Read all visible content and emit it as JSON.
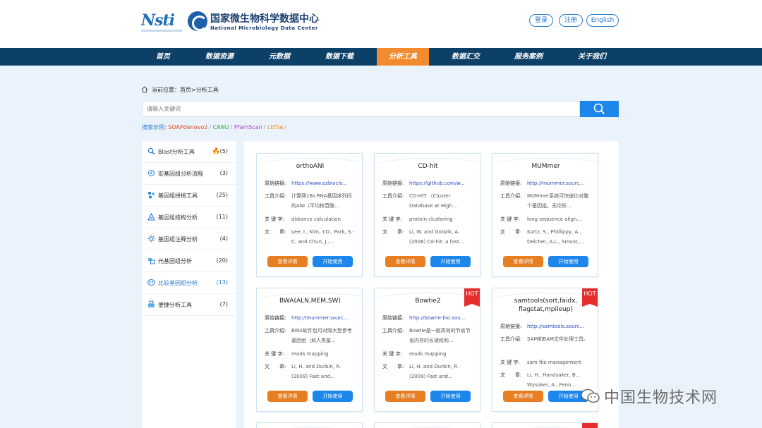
{
  "header": {
    "logo_nsti": "Nsti",
    "logo_cn": "国家微生物科学数据中心",
    "logo_en": "National Microbiology Data Center",
    "login": "登录",
    "register": "注册",
    "english": "English"
  },
  "nav": {
    "items": [
      "首页",
      "数据资源",
      "元数据",
      "数据下载",
      "分析工具",
      "数据汇交",
      "服务案例",
      "关于我们"
    ],
    "active": "分析工具"
  },
  "breadcrumb": {
    "label": "当前位置：",
    "path": "首页>分析工具"
  },
  "search": {
    "placeholder": "请输入关键词"
  },
  "examples": {
    "label": "搜索示例:",
    "items": [
      {
        "text": "SOAPdenovo2",
        "color": "#e8451c"
      },
      {
        "text": "CANU",
        "color": "#2e9e3a"
      },
      {
        "text": "PfamScan",
        "color": "#b33cc8"
      },
      {
        "text": "LEfSe",
        "color": "#f28a2e"
      }
    ]
  },
  "sidebar": {
    "items": [
      {
        "label": "Blast分析工具",
        "count": "(5)",
        "icon": "blast-icon",
        "hot": true
      },
      {
        "label": "宏基因组分析流程",
        "count": "(3)",
        "icon": "metagenome-icon"
      },
      {
        "label": "基因组拼接工具",
        "count": "(25)",
        "icon": "assembly-icon"
      },
      {
        "label": "基因组结构分析",
        "count": "(11)",
        "icon": "structure-icon"
      },
      {
        "label": "基因组注释分析",
        "count": "(4)",
        "icon": "annotation-icon"
      },
      {
        "label": "元基因组分析",
        "count": "(20)",
        "icon": "meta-icon"
      },
      {
        "label": "比较基因组分析",
        "count": "(13)",
        "icon": "compare-icon",
        "active": true
      },
      {
        "label": "便捷分析工具",
        "count": "(7)",
        "icon": "tools-icon"
      }
    ]
  },
  "card_labels": {
    "link": "原始链接:",
    "intro": "工具介绍:",
    "keyword": "关 键 字:",
    "article": "文　　章:",
    "detail": "查看详情",
    "use": "开始使用",
    "hot": "HOT"
  },
  "cards": [
    {
      "title": "orthoANI",
      "link": "https://www.ezbioclo...",
      "intro": "计算两16s RNA基因序列间的ANI（平均核苷酸...",
      "keyword": "distance calculation",
      "article": "Lee, I., Kim, Y.O., Park, S.-C. and Chun, J....."
    },
    {
      "title": "CD-hit",
      "link": "https://github.com/w...",
      "intro": "CD-HIT （Cluster Database at High...",
      "keyword": "protein clustering",
      "article": "Li, W. and Godzik, A. (2006) Cd-hit: a fast..."
    },
    {
      "title": "MUMmer",
      "link": "http://mummer.sourc...",
      "intro": "MUMmer系统可快速比对整个基因组。无论形...",
      "keyword": "long sequence align...",
      "article": "Kurtz, S., Phillippy, A., Delcher, A.L., Smoot,..."
    },
    {
      "title": "BWA(ALN,MEM,SW)",
      "link": "http://mummer.sourc...",
      "intro": "BWA软件包可对照大型参考基因组（如人类基...",
      "keyword": "reads mapping",
      "article": "Li, H. and Durbin, R. (2009) Fast and..."
    },
    {
      "title": "Bowtie2",
      "hot": true,
      "link": "http://bowtie-bio.sou...",
      "intro": "Bowtie是一款高效的节省节省内存的长读段和...",
      "keyword": "reads mapping",
      "article": "Li, H. and Durbin, R. (2009) Fast and..."
    },
    {
      "title": "samtools(sort,faidx, flagstat,mpileup)",
      "hot": true,
      "link": "http://samtools.sourc...",
      "intro": "SAM和BAM文件处理工具。",
      "keyword": "sam file management",
      "article": "Li, H., Handsaker, B., Wysoker, A., Fenn..."
    }
  ],
  "watermark": "中国生物技术网"
}
